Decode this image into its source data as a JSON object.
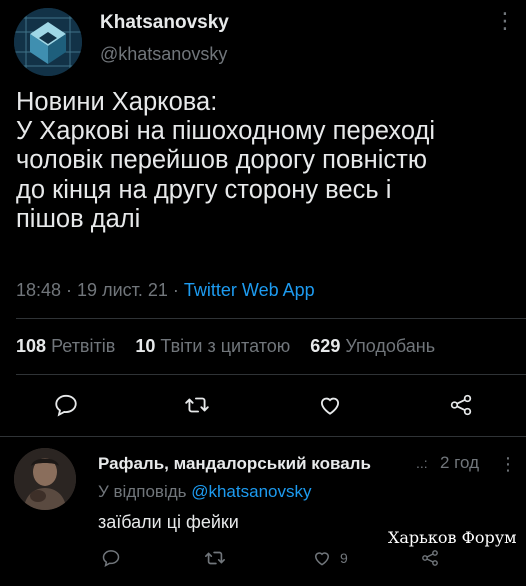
{
  "tweet": {
    "author_name": "Khatsanovsky",
    "author_handle": "@khatsanovsky",
    "more_label": "⋮",
    "text_lines": [
      "Новини Харкова:",
      "У Харкові на пішоходному переході",
      "чоловік перейшов дорогу повністю",
      "до кінця на другу сторону весь і",
      "пішов далі"
    ],
    "time": "18:48 · 19 лист. 21 · ",
    "source_app": "Twitter Web App",
    "retweets_count": "108",
    "retweets_label": "Ретвітів",
    "quotes_count": "10",
    "quotes_label": "Твіти з цитатою",
    "likes_count": "629",
    "likes_label": "Уподобань"
  },
  "icons": {
    "reply": "reply-icon",
    "retweet": "retweet-icon",
    "like": "heart-icon",
    "share": "share-icon"
  },
  "reply": {
    "author_name": "Рафаль, мандалорський коваль",
    "badge": "..:",
    "time": "2 год",
    "more_label": "⋮",
    "replying_to_prefix": "У відповідь ",
    "replying_to_handle": "@khatsanovsky",
    "text": "заїбали ці фейки",
    "like_count": "9"
  },
  "watermark": "Харьков Форум",
  "colors": {
    "background": "#000000",
    "text": "#e7e9ea",
    "muted": "#71767b",
    "link": "#1d9bf0",
    "divider": "#2f3336"
  }
}
